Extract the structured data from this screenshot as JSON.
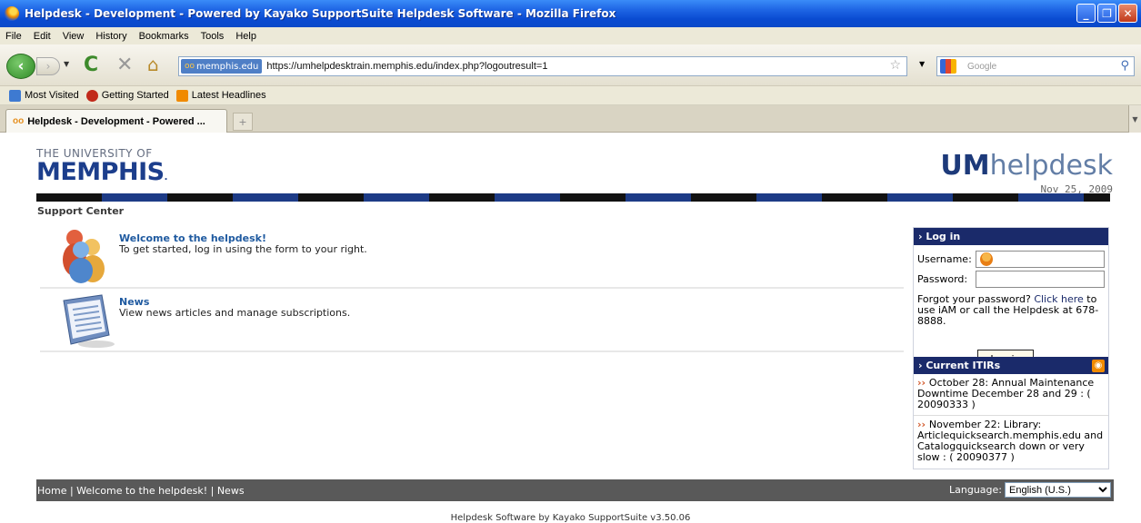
{
  "window": {
    "title": "Helpdesk - Development - Powered by Kayako SupportSuite Helpdesk Software - Mozilla Firefox",
    "min_label": "_",
    "max_label": "❐",
    "close_label": "✕"
  },
  "menu": [
    "File",
    "Edit",
    "View",
    "History",
    "Bookmarks",
    "Tools",
    "Help"
  ],
  "nav": {
    "site_badge": "memphis.edu",
    "url": "https://umhelpdesktrain.memphis.edu/index.php?logoutresult=1",
    "search_placeholder": "Google"
  },
  "bookmarks": [
    {
      "label": "Most Visited",
      "icon": "most-visited-icon",
      "color": "#3e7ad1"
    },
    {
      "label": "Getting Started",
      "icon": "getting-started-icon",
      "color": "#c12a1a"
    },
    {
      "label": "Latest Headlines",
      "icon": "rss-icon",
      "color": "#f08a00"
    }
  ],
  "tab": {
    "label": "Helpdesk - Development - Powered ...",
    "new_tab": "+"
  },
  "header": {
    "univ_line1": "THE UNIVERSITY OF",
    "univ_line2": "MEMPHIS",
    "brand_bold": "UM",
    "brand_rest": "helpdesk",
    "date": "Nov 25, 2009"
  },
  "breadcrumb": "Support Center",
  "items": [
    {
      "title": "Welcome to the helpdesk!",
      "desc": "To get started, log in using the form to your right."
    },
    {
      "title": "News",
      "desc": "View news articles and manage subscriptions."
    }
  ],
  "login": {
    "title": "› Log in",
    "username_label": "Username:",
    "password_label": "Password:",
    "forgot_pre": "Forgot your password? ",
    "forgot_link": "Click here",
    "forgot_post": " to use iAM or call the Helpdesk at 678-8888.",
    "button": "Log in"
  },
  "itirs": {
    "title": "› Current ITIRs",
    "entries": [
      "October 28: Annual Maintenance Downtime December 28 and 29 : ( 20090333 )",
      "November 22: Library: Articlequicksearch.memphis.edu and Catalogquicksearch down or very slow : ( 20090377 )"
    ]
  },
  "footer": {
    "links": "Home | Welcome to the helpdesk! | News",
    "language_label": "Language:",
    "language_value": "English (U.S.)",
    "credit": "Helpdesk Software by Kayako SupportSuite v3.50.06"
  }
}
